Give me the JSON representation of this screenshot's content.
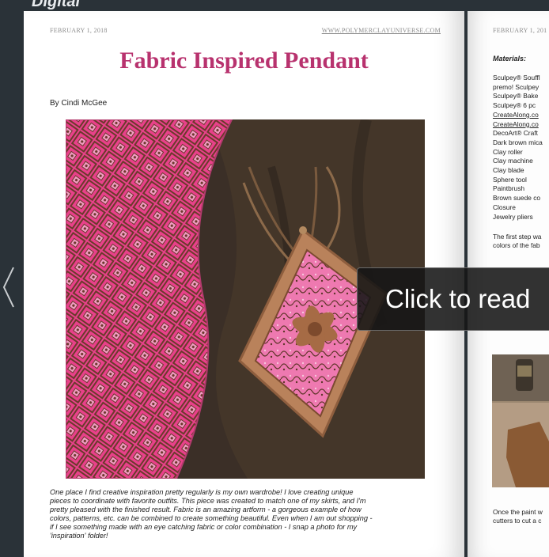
{
  "header_text": "Digital",
  "nav": {
    "prev_icon": "chevron-left-icon"
  },
  "left_page": {
    "date": "FEBRUARY 1, 2018",
    "site": "WWW.POLYMERCLAYUNIVERSE.COM",
    "title": "Fabric Inspired Pendant",
    "byline": "By Cindi McGee",
    "body_lines": [
      "One place I find creative inspiration pretty regularly is my own wardrobe!  I love creating unique",
      "pieces to coordinate with favorite outfits. This piece was created to match one of my skirts, and I'm",
      "pretty pleased with the finished result. Fabric is an amazing artform - a gorgeous example of how",
      "colors, patterns, etc. can be combined to create something beautiful.  Even when I am out shopping -",
      "if I see something made with an eye catching fabric or color combination - I snap a photo for my",
      "'inspiration' folder!"
    ]
  },
  "right_page": {
    "date": "FEBRUARY 1, 201",
    "materials_title": "Materials:",
    "materials": [
      "Sculpey® Souffl",
      "premo! Sculpey",
      "Sculpey® Bake",
      "Sculpey® 6 pc",
      "CreateAlong.co",
      "CreateAlong.co",
      "DecoArt® Craft",
      "Dark brown mica",
      "Clay roller",
      "Clay machine",
      "Clay blade",
      "Sphere tool",
      "Paintbrush",
      "Brown suede co",
      "Closure",
      "Jewelry pliers"
    ],
    "para1_lines": [
      "The first step wa",
      "colors of the fab"
    ],
    "para2_lines": [
      "Once the paint w",
      "cutters to cut a c"
    ]
  },
  "overlay": {
    "cta_label": "Click to read"
  },
  "colors": {
    "title": "#b8326e",
    "viewer_bg": "#2a3238",
    "page_bg": "#ffffff"
  }
}
